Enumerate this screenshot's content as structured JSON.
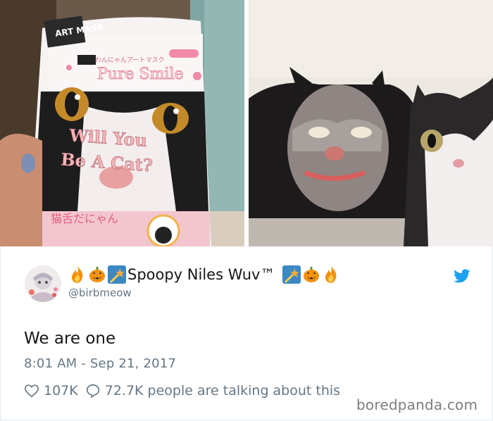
{
  "images": {
    "left": {
      "package_brand": "ART MASK",
      "package_subtitle": "わんにゃんアートマスク",
      "package_product": "Pure Smile",
      "package_title_line1": "Will You",
      "package_title_line2": "Be A Cat?",
      "package_japanese": "猫舌だにゃん"
    },
    "right": {}
  },
  "tweet": {
    "display_name": "Spoopy Niles Wuv™",
    "handle": "@birbmeow",
    "text": "We are one",
    "timestamp": "8:01 AM - Sep 21, 2017",
    "likes": "107K",
    "replies": "72.7K people are talking about this"
  },
  "watermark": "boredpanda.com",
  "colors": {
    "twitter_blue": "#1da1f2",
    "text_dark": "#14171a",
    "text_gray": "#657786",
    "package_pink": "#f08aa6",
    "package_salmon": "#e8a0a0"
  },
  "icons": {
    "name_emojis": [
      "fire",
      "jack-o-lantern",
      "shooting-star"
    ],
    "like": "heart-icon",
    "reply": "speech-bubble-icon",
    "brand": "twitter-bird-icon"
  }
}
